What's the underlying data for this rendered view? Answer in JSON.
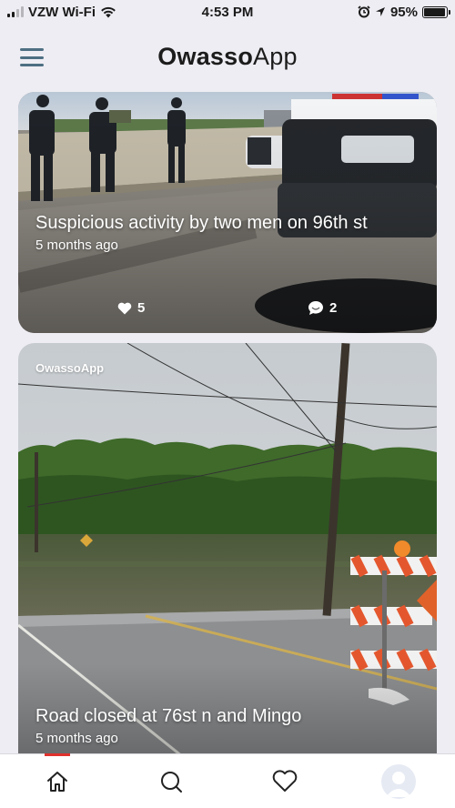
{
  "status_bar": {
    "carrier": "VZW Wi-Fi",
    "time": "4:53 PM",
    "battery": "95%",
    "battery_level": 0.95
  },
  "header": {
    "title_bold": "Owasso",
    "title_light": "App"
  },
  "feed": [
    {
      "title": "Suspicious activity by two men on 96th st",
      "time": "5 months ago",
      "likes": "5",
      "comments": "2"
    },
    {
      "brand": "OwassoApp",
      "title": "Road closed at 76st n and Mingo",
      "time": "5 months ago"
    }
  ],
  "tabbar": {
    "items": [
      "home-icon",
      "search-icon",
      "heart-icon",
      "profile-avatar"
    ],
    "active_color": "#e0312c"
  },
  "colors": {
    "background": "#eeedf3",
    "menu": "#4d6f82",
    "accent": "#e0312c"
  }
}
